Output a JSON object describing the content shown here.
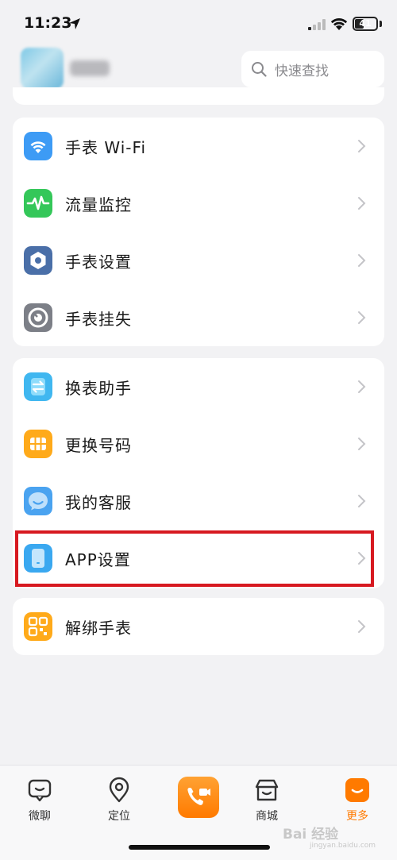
{
  "status_bar": {
    "time": "11:23",
    "battery": "41",
    "battery_level": 0.41
  },
  "header": {
    "username": "",
    "search_placeholder": "快速查找"
  },
  "groups": [
    {
      "items": [
        {
          "label": "手表 Wi-Fi",
          "icon": "wifi-icon",
          "color": "#3d9bf5"
        },
        {
          "label": "流量监控",
          "icon": "pulse-icon",
          "color": "#34c759"
        },
        {
          "label": "手表设置",
          "icon": "hexagon-settings-icon",
          "color": "#4a6fa8"
        },
        {
          "label": "手表挂失",
          "icon": "lost-watch-icon",
          "color": "#7c7f87"
        }
      ]
    },
    {
      "items": [
        {
          "label": "换表助手",
          "icon": "swap-watch-icon",
          "color": "#40b7f0"
        },
        {
          "label": "更换号码",
          "icon": "sim-card-icon",
          "color": "#ffaa1a"
        },
        {
          "label": "我的客服",
          "icon": "chat-bubble-icon",
          "color": "#4aa3f0"
        },
        {
          "label": "APP设置",
          "icon": "phone-settings-icon",
          "color": "#3aa8f0",
          "highlighted": true
        }
      ]
    },
    {
      "items": [
        {
          "label": "解绑手表",
          "icon": "unbind-qr-icon",
          "color": "#ffaa1a"
        }
      ]
    }
  ],
  "tab_bar": {
    "tabs": [
      {
        "label": "微聊",
        "icon": "chat-icon"
      },
      {
        "label": "定位",
        "icon": "location-pin-icon"
      },
      {
        "label": "",
        "icon": "video-call-icon"
      },
      {
        "label": "商城",
        "icon": "store-icon"
      },
      {
        "label": "更多",
        "icon": "more-icon",
        "active": true
      }
    ]
  },
  "colors": {
    "accent": "#ff7a00",
    "highlight_border": "#d71920",
    "background": "#f2f2f4"
  },
  "watermark": {
    "text": "Bai 经验",
    "sub": "jingyan.baidu.com"
  }
}
